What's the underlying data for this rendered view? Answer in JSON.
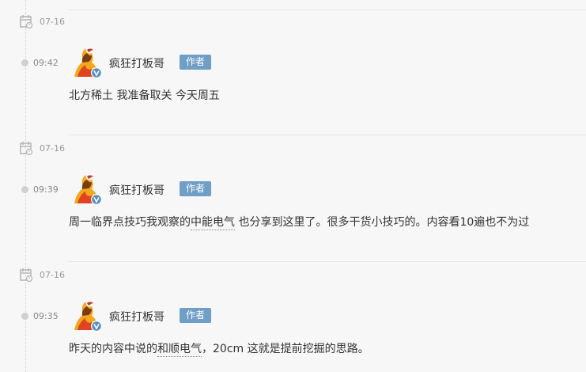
{
  "feed": [
    {
      "date": "07-16",
      "time": "09:42",
      "author": "疯狂打板哥",
      "badge": "作者",
      "parts": [
        {
          "text": "北方稀土 我准备取关 今天周五",
          "kw": false
        }
      ]
    },
    {
      "date": "07-16",
      "time": "09:39",
      "author": "疯狂打板哥",
      "badge": "作者",
      "parts": [
        {
          "text": "周一临界点技巧我观察的",
          "kw": false
        },
        {
          "text": "中能电气",
          "kw": true
        },
        {
          "text": " 也分享到这里了。很多干货小技巧的。内容看10遍也不为过",
          "kw": false
        }
      ]
    },
    {
      "date": "07-16",
      "time": "09:35",
      "author": "疯狂打板哥",
      "badge": "作者",
      "parts": [
        {
          "text": "昨天的内容中说的",
          "kw": false
        },
        {
          "text": "和顺电气",
          "kw": true
        },
        {
          "text": "，20cm 这就是提前挖掘的思路。",
          "kw": false
        }
      ]
    }
  ],
  "colors": {
    "badge": "#6f9ec6",
    "background": "#f7f7f7",
    "verified": "#5a8fc6"
  },
  "icons": {
    "date": "calendar-icon",
    "time": "timeline-dot-icon",
    "verified": "verified-v-icon"
  }
}
